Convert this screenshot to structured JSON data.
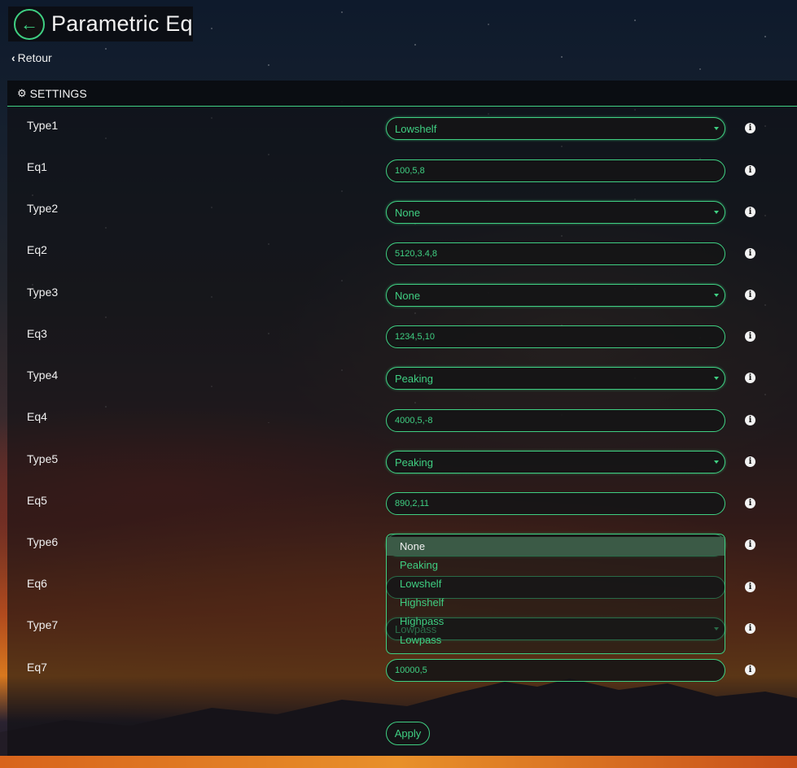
{
  "header": {
    "title": "Parametric Eq",
    "back_label": "Retour"
  },
  "panel": {
    "title": "SETTINGS"
  },
  "rows": [
    {
      "label": "Type1",
      "kind": "select",
      "value": "Lowshelf"
    },
    {
      "label": "Eq1",
      "kind": "input",
      "value": "100,5,8"
    },
    {
      "label": "Type2",
      "kind": "select",
      "value": "None"
    },
    {
      "label": "Eq2",
      "kind": "input",
      "value": "5120,3.4,8"
    },
    {
      "label": "Type3",
      "kind": "select",
      "value": "None"
    },
    {
      "label": "Eq3",
      "kind": "input",
      "value": "1234,5,10"
    },
    {
      "label": "Type4",
      "kind": "select",
      "value": "Peaking"
    },
    {
      "label": "Eq4",
      "kind": "input",
      "value": "4000,5,-8"
    },
    {
      "label": "Type5",
      "kind": "select",
      "value": "Peaking"
    },
    {
      "label": "Eq5",
      "kind": "input",
      "value": "890,2,11"
    },
    {
      "label": "Type6",
      "kind": "select",
      "value": "None"
    },
    {
      "label": "Eq6",
      "kind": "input",
      "value": ""
    },
    {
      "label": "Type7",
      "kind": "select",
      "value": "Lowpass"
    },
    {
      "label": "Eq7",
      "kind": "input",
      "value": "10000,5"
    }
  ],
  "dropdown": {
    "options": [
      "None",
      "Peaking",
      "Lowshelf",
      "Highshelf",
      "Highpass",
      "Lowpass"
    ],
    "highlighted": "None"
  },
  "apply_label": "Apply",
  "colors": {
    "accent": "#3fcf82",
    "panel": "#0f0f12",
    "highlight": "#3b5a46"
  },
  "icons": {
    "back": "arrow-left-icon",
    "settings": "gears-icon",
    "info": "info-circle-icon",
    "chevron": "chevron-left-icon"
  }
}
